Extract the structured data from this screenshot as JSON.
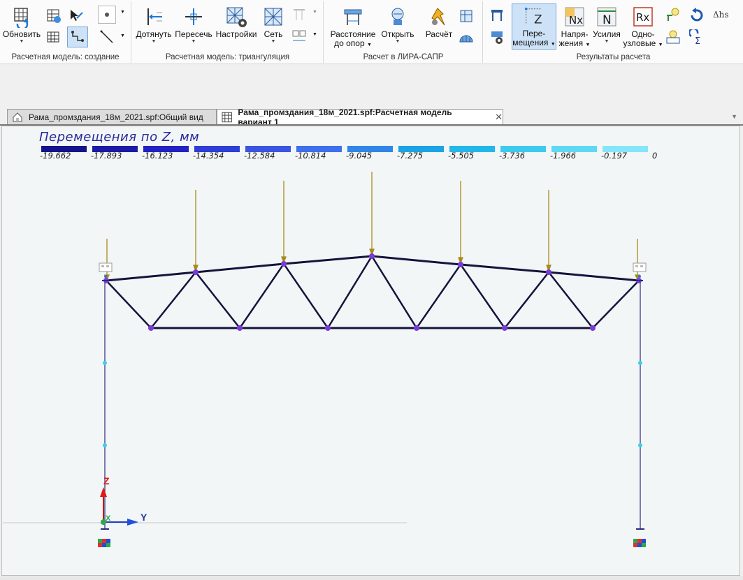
{
  "ribbon": {
    "groups": [
      {
        "label": "Расчетная модель: создание"
      },
      {
        "label": "Расчетная модель: триангуляция"
      },
      {
        "label": "Расчет в ЛИРА-САПР"
      },
      {
        "label": "Результаты расчета"
      }
    ],
    "buttons": {
      "update": "Обновить",
      "extend": "Дотянуть",
      "cross": "Пересечь",
      "settings": "Настройки",
      "mesh": "Сеть",
      "distance_line1": "Расстояние",
      "distance_line2": "до опор",
      "open": "Открыть",
      "calc": "Расчёт",
      "displacements_line1": "Пере-",
      "displacements_line2": "мещения",
      "stresses_line1": "Напря-",
      "stresses_line2": "жения",
      "forces": "Усилия",
      "nodal_line1": "Одно-",
      "nodal_line2": "узловые"
    },
    "icon_glyphs": {
      "nx": "Nx",
      "n": "N",
      "rx": "Rx",
      "z": "Z",
      "delta_hs": "Δhs",
      "sigma": "Σ"
    }
  },
  "tabs": [
    {
      "label": "Рама_промздания_18м_2021.spf:Общий вид",
      "active": false
    },
    {
      "label": "Рама_промздания_18м_2021.spf:Расчетная модель вариант 1",
      "active": true,
      "close": "✕"
    }
  ],
  "legend": {
    "title": "Перемещения по Z, мм",
    "values": [
      "-19.662",
      "-17.893",
      "-16.123",
      "-14.354",
      "-12.584",
      "-10.814",
      "-9.045",
      "-7.275",
      "-5.505",
      "-3.736",
      "-1.966",
      "-0.197",
      "0"
    ],
    "colors": [
      "#14148a",
      "#1a1aa6",
      "#2222c4",
      "#2e3ed6",
      "#3a55e2",
      "#3f6fec",
      "#2f86e8",
      "#1ca3e6",
      "#22b7ea",
      "#3ecaf0",
      "#5fd8f4",
      "#84e6f8"
    ]
  },
  "axes": {
    "z_label": "Z",
    "y_label": "Y",
    "x_label": "X"
  },
  "colors": {
    "accent_active": "#cde2f7",
    "truss": "#14143c",
    "load": "#a88a1a",
    "node": "#7a3ad8",
    "column": "#2b2b7a"
  }
}
